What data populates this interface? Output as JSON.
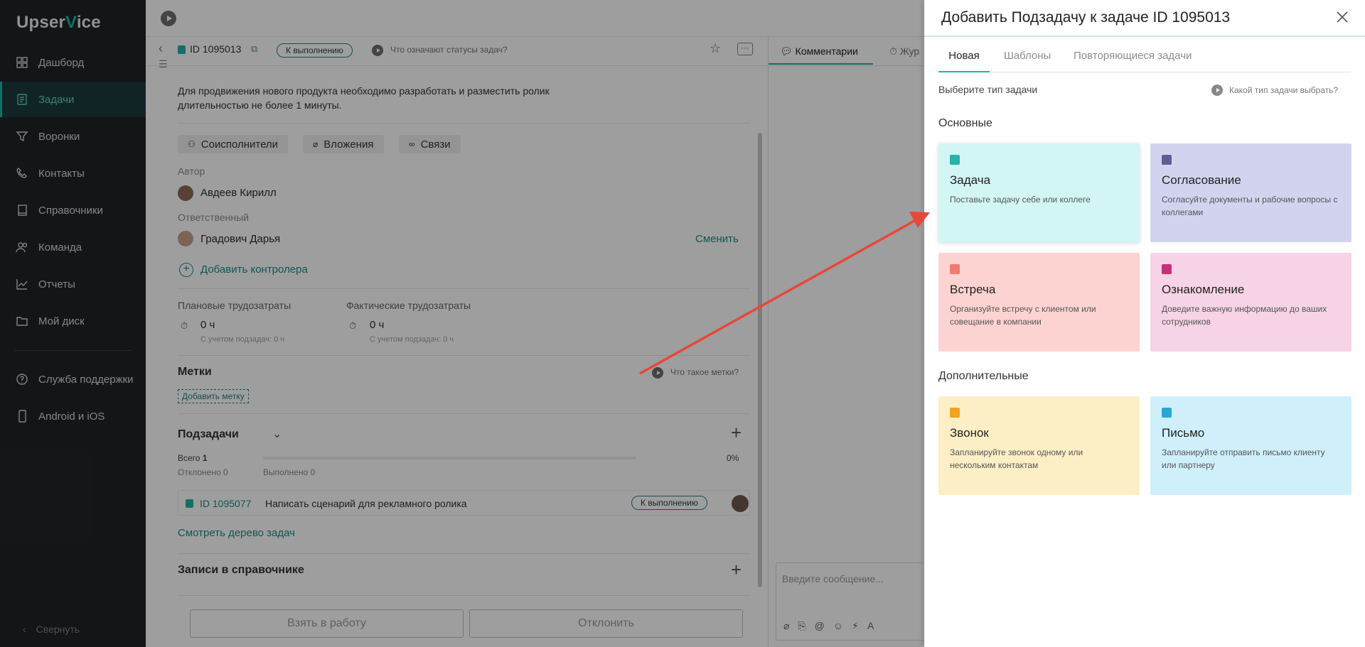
{
  "sidebar": {
    "logo_a": "Upser",
    "logo_v": "V",
    "logo_b": "ice",
    "items": [
      {
        "label": "Дашборд",
        "icon": "dashboard-icon"
      },
      {
        "label": "Задачи",
        "icon": "tasks-icon",
        "active": true
      },
      {
        "label": "Воронки",
        "icon": "funnel-icon"
      },
      {
        "label": "Контакты",
        "icon": "phone-icon"
      },
      {
        "label": "Справочники",
        "icon": "book-icon"
      },
      {
        "label": "Команда",
        "icon": "team-icon"
      },
      {
        "label": "Отчеты",
        "icon": "chart-icon"
      },
      {
        "label": "Мой диск",
        "icon": "folder-icon"
      }
    ],
    "support": [
      {
        "label": "Служба поддержки",
        "icon": "help-icon"
      },
      {
        "label": "Android и iOS",
        "icon": "mobile-icon"
      }
    ],
    "collapse_label": "Свернуть"
  },
  "task": {
    "id": "ID 1095013",
    "status": "К выполнению",
    "status_help": "Что означают статусы задач?",
    "description": "Для продвижения нового продукта необходимо разработать и разместить ролик длительностью не более 1 минуты.",
    "chips": [
      "Соисполнители",
      "Вложения",
      "Связи"
    ],
    "author_label": "Автор",
    "author_name": "Авдеев Кирилл",
    "responsible_label": "Ответственный",
    "responsible_name": "Градович Дарья",
    "change_link": "Сменить",
    "add_controller": "Добавить контролера",
    "planned_label": "Плановые трудозатраты",
    "planned_value": "0 ч",
    "planned_sub": "С учетом подзадач: 0 ч",
    "actual_label": "Фактические трудозатраты",
    "actual_value": "0 ч",
    "actual_sub": "С учетом подзадач: 0 ч",
    "tags_title": "Метки",
    "tags_help": "Что такое метки?",
    "add_tag": "Добавить метку",
    "subtasks_title": "Подзадачи",
    "total_label": "Всего",
    "total_value": "1",
    "rejected": "Отклонено 0",
    "done": "Выполнено 0",
    "progress_percent": "0%",
    "progress_fraction": 0,
    "subtask_id": "ID 1095077",
    "subtask_name": "Написать сценарий для рекламного ролика",
    "subtask_status": "К выполнению",
    "tree_link": "Смотреть дерево задач",
    "records_title": "Записи в справочнике",
    "take_button": "Взять в работу",
    "reject_button": "Отклонить"
  },
  "comments": {
    "tab_comments": "Комментарии",
    "tab_journal": "Жур",
    "input_placeholder": "Введите сообщение..."
  },
  "panel": {
    "title": "Добавить Подзадачу к задаче ID 1095013",
    "tabs": [
      "Новая",
      "Шаблоны",
      "Повторяющиеся задачи"
    ],
    "choose_label": "Выберите тип задачи",
    "choose_help": "Какой тип задачи выбрать?",
    "main_section": "Основные",
    "extra_section": "Дополнительные",
    "cards": [
      {
        "title": "Задача",
        "desc": "Поставьте задачу себе или коллеге",
        "bg": "#d2f6f4",
        "icon_color": "#26b3ac",
        "icon": "task-icon"
      },
      {
        "title": "Согласование",
        "desc": "Согласуйте документы и рабочие вопросы с коллегами",
        "bg": "#d2d4ef",
        "icon_color": "#5b5f96",
        "icon": "approval-icon"
      },
      {
        "title": "Встреча",
        "desc": "Организуйте встречу с клиентом или совещание в компании",
        "bg": "#fdd3d1",
        "icon_color": "#f07b74",
        "icon": "clock-icon"
      },
      {
        "title": "Ознакомление",
        "desc": "Доведите важную информацию до ваших сотрудников",
        "bg": "#f6d3e6",
        "icon_color": "#c4327a",
        "icon": "eye-icon"
      },
      {
        "title": "Звонок",
        "desc": "Запланируйте звонок одному или нескольким контактам",
        "bg": "#fdefc5",
        "icon_color": "#f0a31b",
        "icon": "phone-icon"
      },
      {
        "title": "Письмо",
        "desc": "Запланируйте отправить письмо клиенту или партнеру",
        "bg": "#cff0fa",
        "icon_color": "#2aa6d3",
        "icon": "mail-icon"
      }
    ]
  },
  "colors": {
    "accent": "#1bb5a8",
    "arrow": "#e8473b"
  }
}
